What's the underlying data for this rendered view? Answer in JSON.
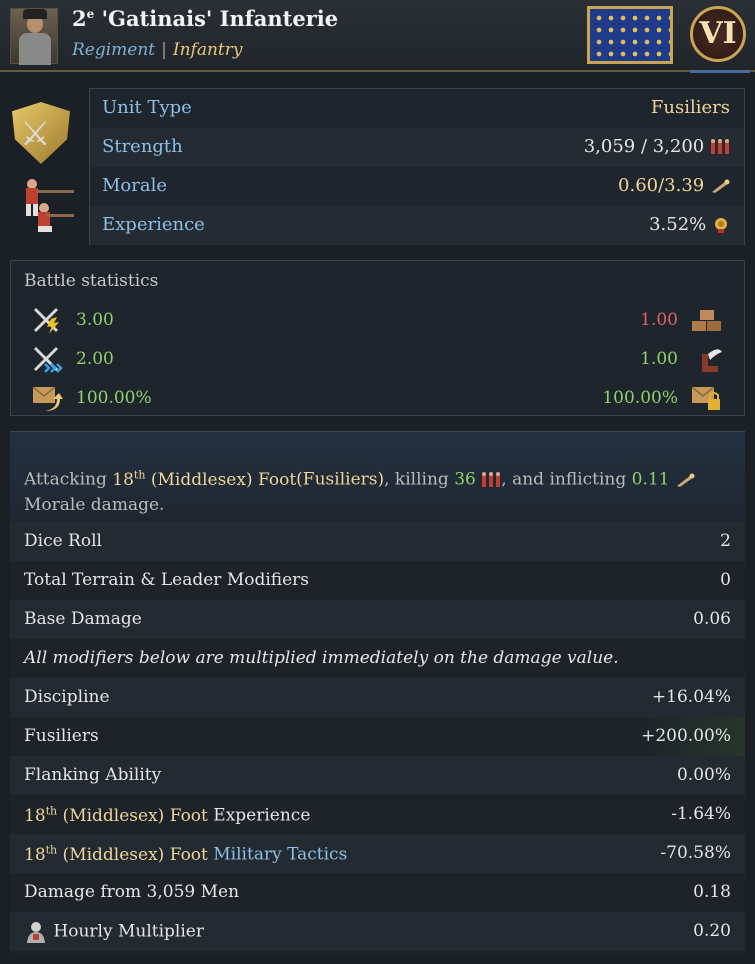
{
  "header": {
    "title_prefix": "2",
    "title_sup": "e",
    "title_name": " 'Gatinais' Infanterie",
    "subtitle_regiment": "Regiment",
    "subtitle_sep": "|",
    "subtitle_type": "Infantry",
    "rank": "VI"
  },
  "unit": {
    "rows": [
      {
        "label": "Unit Type",
        "value": "Fusiliers"
      },
      {
        "label": "Strength",
        "value": "3,059 / 3,200"
      },
      {
        "label": "Morale",
        "value": "0.60/3.39"
      },
      {
        "label": "Experience",
        "value": "3.52%"
      }
    ]
  },
  "battle": {
    "title": "Battle statistics",
    "rows": [
      {
        "left": "3.00",
        "right": "1.00",
        "left_icon": "crossed-swords-lightning-icon",
        "right_icon": "bricks-icon"
      },
      {
        "left": "2.00",
        "right": "1.00",
        "left_icon": "crossed-swords-arrows-icon",
        "right_icon": "winged-boot-icon"
      },
      {
        "left": "100.00%",
        "right": "100.00%",
        "left_icon": "envelope-arrow-icon",
        "right_icon": "envelope-lock-icon"
      }
    ]
  },
  "breakdown": {
    "desc": {
      "a": "Attacking ",
      "target_num": "18",
      "target_sup": "th",
      "target_name": " (Middlesex) Foot",
      "target_type": "(Fusiliers)",
      "b": ", killing ",
      "kills": "36",
      "c": ", and inflicting ",
      "morale": "0.11",
      "d": "Morale damage."
    },
    "dice_label": "Dice Roll",
    "dice_value": "2",
    "terrain_label": "Total Terrain & Leader Modifiers",
    "terrain_value": "0",
    "base_label": "Base Damage",
    "base_value": "0.06",
    "note": "All modifiers below are multiplied immediately on the damage value.",
    "discipline_label": "Discipline",
    "discipline_value": "+16.04%",
    "fusiliers_label": "Fusiliers",
    "fusiliers_value": "+200.00%",
    "flanking_label": "Flanking Ability",
    "flanking_value": "0.00%",
    "exp_num": "18",
    "exp_sup": "th",
    "exp_name": " (Middlesex) Foot",
    "exp_label": " Experience",
    "exp_value": "-1.64%",
    "tac_num": "18",
    "tac_sup": "th",
    "tac_name": " (Middlesex) Foot",
    "tac_label": " Military Tactics",
    "tac_value": "-70.58%",
    "men_label": "Damage from 3,059 Men",
    "men_value": "0.18",
    "hourly_label": "Hourly Multiplier",
    "hourly_value": "0.20"
  },
  "colors": {
    "label_blue": "#8cc0e6",
    "gold": "#eed59a",
    "green": "#8fd16b",
    "red": "#e0606a"
  }
}
